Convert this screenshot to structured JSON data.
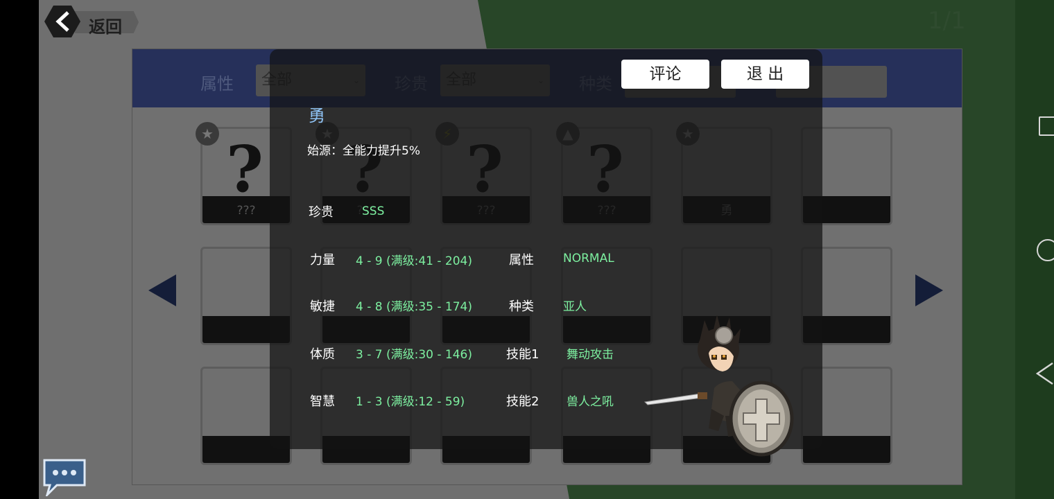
{
  "header": {
    "back_label": "返回",
    "page_indicator": "1/1"
  },
  "filters": [
    {
      "label": "属性",
      "value": "全部"
    },
    {
      "label": "珍贵",
      "value": "全部"
    },
    {
      "label": "种类",
      "value": ""
    }
  ],
  "cards": [
    {
      "name": "???",
      "badge": "star-icon",
      "unknown": true
    },
    {
      "name": "???",
      "badge": "star-icon",
      "unknown": true
    },
    {
      "name": "???",
      "badge": "lightning-icon",
      "unknown": true
    },
    {
      "name": "???",
      "badge": "triangle-icon",
      "unknown": true
    },
    {
      "name": "勇",
      "badge": "star-icon",
      "unknown": false
    },
    {
      "name": "",
      "badge": "",
      "unknown": false
    }
  ],
  "detail": {
    "name": "勇",
    "origin": "始源：全能力提升5%",
    "rarity_label": "珍贵",
    "rarity_value": "SSS",
    "stats": [
      {
        "label": "力量",
        "value": "4 - 9 (满级:41 - 204)"
      },
      {
        "label": "敏捷",
        "value": "4 - 8 (满级:35 - 174)"
      },
      {
        "label": "体质",
        "value": "3 - 7 (满级:30 - 146)"
      },
      {
        "label": "智慧",
        "value": "1 - 3 (满级:12 - 59)"
      }
    ],
    "attrs": [
      {
        "label": "属性",
        "value": "NORMAL"
      },
      {
        "label": "种类",
        "value": "亚人"
      },
      {
        "label": "技能1",
        "value": "舞动攻击"
      },
      {
        "label": "技能2",
        "value": "兽人之吼"
      }
    ],
    "buttons": {
      "comment": "评论",
      "exit": "退 出"
    }
  },
  "colors": {
    "stat_value": "#7df0a0",
    "hero_name": "#8fc3f5",
    "filter_bar": "#26305a"
  }
}
